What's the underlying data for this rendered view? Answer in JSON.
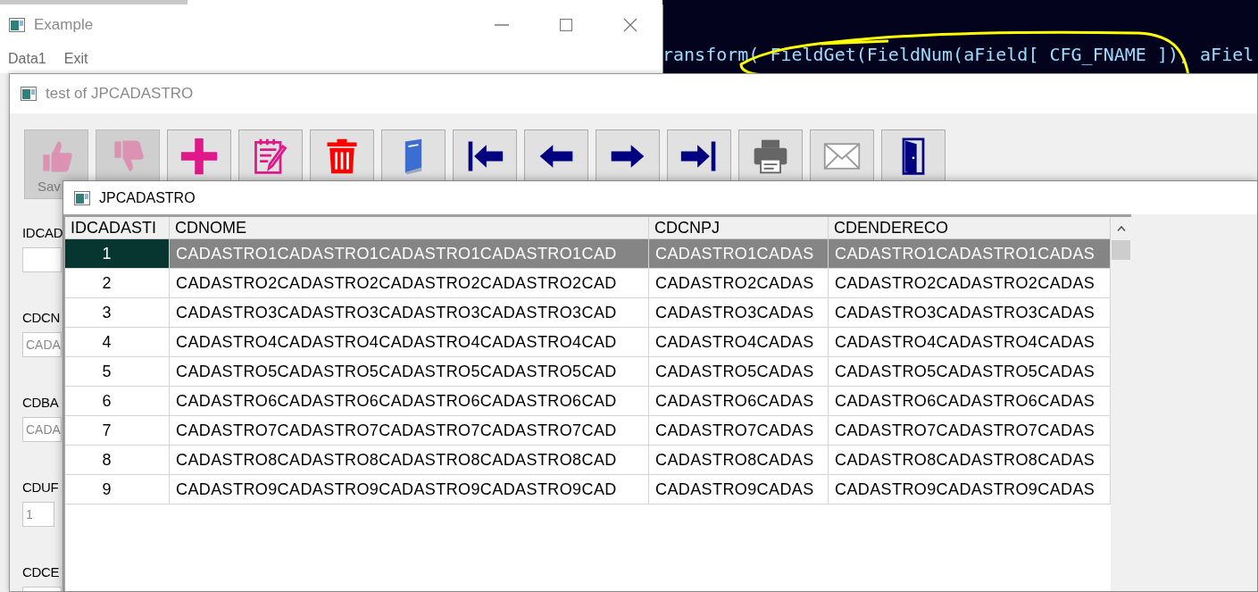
{
  "editor": {
    "code_line": "ransform( FieldGet(FieldNum(aField[ CFG_FNAME ]), aFiel"
  },
  "example_window": {
    "title": "Example",
    "menu": [
      "Data1",
      "Exit"
    ]
  },
  "form_window": {
    "title": "test of JPCADASTRO",
    "toolbar": [
      {
        "label": "Sav",
        "disabled": true
      },
      {
        "disabled": true
      },
      {
        "disabled": false
      },
      {
        "disabled": false
      },
      {
        "disabled": false
      },
      {
        "disabled": false
      },
      {
        "disabled": false
      },
      {
        "disabled": false
      },
      {
        "disabled": false
      },
      {
        "disabled": false
      },
      {
        "disabled": false
      },
      {
        "disabled": false
      },
      {
        "disabled": false
      }
    ],
    "fields": [
      {
        "label": "IDCAD"
      },
      {
        "label": "CDCN",
        "value": "CADA"
      },
      {
        "label": "CDBA",
        "value": "CADA"
      },
      {
        "label": "CDUF",
        "value": "1"
      },
      {
        "label": "CDCE"
      }
    ]
  },
  "grid_window": {
    "title": "JPCADASTRO",
    "table": {
      "columns": [
        "IDCADASTI",
        "CDNOME",
        "CDCNPJ",
        "CDENDERECO"
      ],
      "rows": [
        {
          "selected": true,
          "cells": [
            "1",
            "CADASTRO1CADASTRO1CADASTRO1CADASTRO1CAD",
            "CADASTRO1CADAS",
            "CADASTRO1CADASTRO1CADAS"
          ]
        },
        {
          "selected": false,
          "cells": [
            "2",
            "CADASTRO2CADASTRO2CADASTRO2CADASTRO2CAD",
            "CADASTRO2CADAS",
            "CADASTRO2CADASTRO2CADAS"
          ]
        },
        {
          "selected": false,
          "cells": [
            "3",
            "CADASTRO3CADASTRO3CADASTRO3CADASTRO3CAD",
            "CADASTRO3CADAS",
            "CADASTRO3CADASTRO3CADAS"
          ]
        },
        {
          "selected": false,
          "cells": [
            "4",
            "CADASTRO4CADASTRO4CADASTRO4CADASTRO4CAD",
            "CADASTRO4CADAS",
            "CADASTRO4CADASTRO4CADAS"
          ]
        },
        {
          "selected": false,
          "cells": [
            "5",
            "CADASTRO5CADASTRO5CADASTRO5CADASTRO5CAD",
            "CADASTRO5CADAS",
            "CADASTRO5CADASTRO5CADAS"
          ]
        },
        {
          "selected": false,
          "cells": [
            "6",
            "CADASTRO6CADASTRO6CADASTRO6CADASTRO6CAD",
            "CADASTRO6CADAS",
            "CADASTRO6CADASTRO6CADAS"
          ]
        },
        {
          "selected": false,
          "cells": [
            "7",
            "CADASTRO7CADASTRO7CADASTRO7CADASTRO7CAD",
            "CADASTRO7CADAS",
            "CADASTRO7CADASTRO7CADAS"
          ]
        },
        {
          "selected": false,
          "cells": [
            "8",
            "CADASTRO8CADASTRO8CADASTRO8CADASTRO8CAD",
            "CADASTRO8CADAS",
            "CADASTRO8CADASTRO8CADAS"
          ]
        },
        {
          "selected": false,
          "cells": [
            "9",
            "CADASTRO9CADASTRO9CADASTRO9CADASTRO9CAD",
            "CADASTRO9CADAS",
            "CADASTRO9CADASTRO9CADAS"
          ]
        }
      ]
    }
  }
}
